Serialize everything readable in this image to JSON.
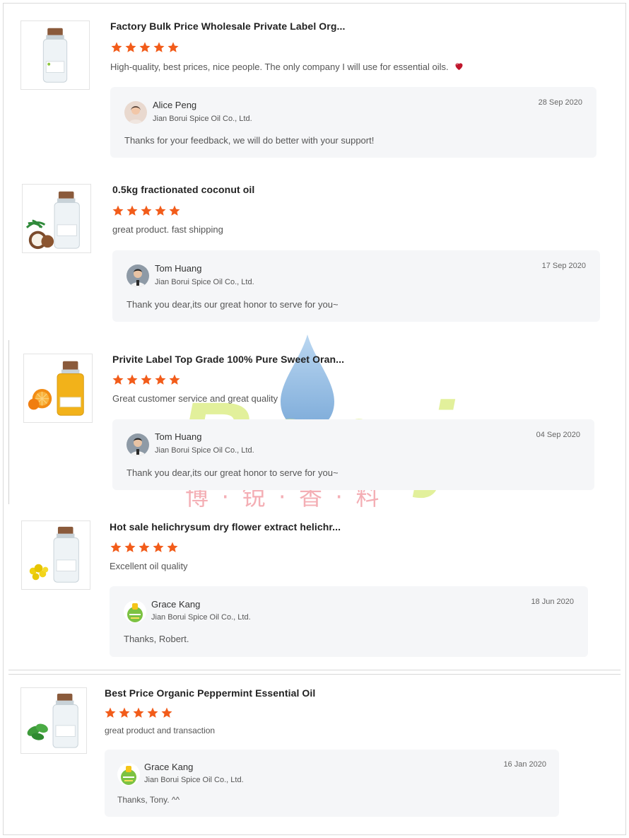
{
  "reviews": [
    {
      "product_title": "Factory Bulk Price Wholesale Private Label Org...",
      "product_icon": "bottle-icon",
      "rating": 5,
      "comment": "High-quality, best prices, nice people. The only company I will use for essential oils.",
      "comment_emoji": "heart-icon",
      "reply": {
        "name": "Alice Peng",
        "company": "Jian Borui Spice Oil Co., Ltd.",
        "date": "28 Sep 2020",
        "text": "Thanks for your feedback,  we will do better with your support!"
      }
    },
    {
      "product_title": "0.5kg fractionated coconut oil",
      "product_icon": "coconut-oil-bottle-icon",
      "rating": 5,
      "comment": "great product. fast shipping",
      "reply": {
        "name": "Tom Huang",
        "company": "Jian Borui Spice Oil Co., Ltd.",
        "date": "17 Sep 2020",
        "text": "Thank you dear,its our great honor to serve for you~"
      }
    },
    {
      "product_title": "Privite Label Top Grade 100% Pure Sweet Oran...",
      "product_icon": "orange-oil-bottle-icon",
      "rating": 5,
      "comment": "Great customer service and great quality",
      "reply": {
        "name": "Tom Huang",
        "company": "Jian Borui Spice Oil Co., Ltd.",
        "date": "04 Sep 2020",
        "text": "Thank you dear,its our great honor to serve for you~"
      }
    },
    {
      "product_title": "Hot sale helichrysum dry flower extract helichr...",
      "product_icon": "helichrysum-oil-bottle-icon",
      "rating": 5,
      "comment": "Excellent oil quality",
      "reply": {
        "name": "Grace Kang",
        "company": "Jian Borui Spice Oil Co., Ltd.",
        "date": "18 Jun 2020",
        "text": "Thanks, Robert."
      }
    },
    {
      "product_title": "Best Price Organic Peppermint Essential Oil",
      "product_icon": "peppermint-oil-bottle-icon",
      "rating": 5,
      "comment": "great product and transaction",
      "reply": {
        "name": "Grace Kang",
        "company": "Jian Borui Spice Oil Co., Ltd.",
        "date": "16 Jan 2020",
        "text": "Thanks, Tony. ^^"
      }
    }
  ],
  "watermark": {
    "brand": "Boruj",
    "chinese": "博 · 锐 · 香 · 料"
  },
  "colors": {
    "star": "#f25c1a",
    "reply_bg": "#f5f6f8",
    "watermark_green": "#d9ec7a",
    "watermark_drop": "#6fa8dc"
  }
}
